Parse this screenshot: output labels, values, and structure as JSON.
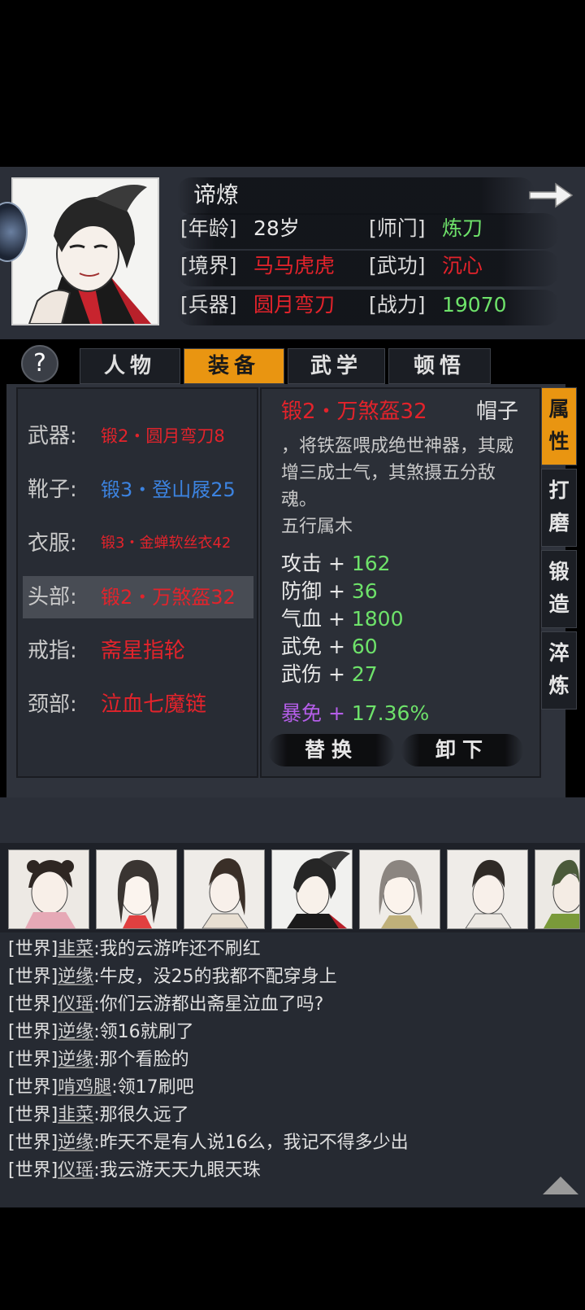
{
  "character": {
    "name": "谛燎",
    "age_label": "[年龄]",
    "age": "28岁",
    "school_label": "[师门]",
    "school": "炼刀",
    "realm_label": "[境界]",
    "realm": "马马虎虎",
    "skill_label": "[武功]",
    "skill": "沉心",
    "weapon_label": "[兵器]",
    "weapon": "圆月弯刀",
    "power_label": "[战力]",
    "power": "19070"
  },
  "tabs": {
    "help": "?",
    "items": [
      "人物",
      "装备",
      "武学",
      "顿悟"
    ],
    "active": "装备"
  },
  "equipment": [
    {
      "slot": "武器:",
      "item": "锻2・圆月弯刀8",
      "color": "#e3232b"
    },
    {
      "slot": "靴子:",
      "item": "锻3・登山屐25",
      "color": "#3c83e0"
    },
    {
      "slot": "衣服:",
      "item": "锻3・金蝉软丝衣42",
      "color": "#e3232b"
    },
    {
      "slot": "头部:",
      "item": "锻2・万煞盔32",
      "color": "#e3232b",
      "selected": true
    },
    {
      "slot": "戒指:",
      "item": "斋星指轮",
      "color": "#e3232b"
    },
    {
      "slot": "颈部:",
      "item": "泣血七魔链",
      "color": "#e3232b"
    }
  ],
  "detail": {
    "title": "锻2・万煞盔32",
    "slot": "帽子",
    "description": "，将铁盔喂成绝世神器，其威增三成士气，其煞摄五分敌魂。",
    "element": "五行属木",
    "stats": [
      {
        "name": "攻击",
        "plus": "+",
        "value": "162"
      },
      {
        "name": "防御",
        "plus": "+",
        "value": "36"
      },
      {
        "name": "气血",
        "plus": "+",
        "value": "1800"
      },
      {
        "name": "武免",
        "plus": "+",
        "value": "60"
      },
      {
        "name": "武伤",
        "plus": "+",
        "value": "27"
      }
    ],
    "special_stat": {
      "name": "暴免",
      "plus": "+",
      "value": "17.36%"
    },
    "replace_button": "替换",
    "unequip_button": "卸下"
  },
  "side_tabs": [
    {
      "label1": "属",
      "label2": "性",
      "active": true
    },
    {
      "label1": "打",
      "label2": "磨",
      "active": false
    },
    {
      "label1": "锻",
      "label2": "造",
      "active": false
    },
    {
      "label1": "淬",
      "label2": "炼",
      "active": false
    }
  ],
  "chat": [
    {
      "channel": "[世界]",
      "user": "韭菜",
      "message": ":我的云游咋还不刷红"
    },
    {
      "channel": "[世界]",
      "user": "逆缘",
      "message": ":牛皮，没25的我都不配穿身上"
    },
    {
      "channel": "[世界]",
      "user": "仪瑶",
      "message": ":你们云游都出斋星泣血了吗?"
    },
    {
      "channel": "[世界]",
      "user": "逆缘",
      "message": ":领16就刷了"
    },
    {
      "channel": "[世界]",
      "user": "逆缘",
      "message": ":那个看脸的"
    },
    {
      "channel": "[世界]",
      "user": "啃鸡腿",
      "message": ":领17刷吧"
    },
    {
      "channel": "[世界]",
      "user": "韭菜",
      "message": ":那很久远了"
    },
    {
      "channel": "[世界]",
      "user": "逆缘",
      "message": ":昨天不是有人说16么，我记不得多少出"
    },
    {
      "channel": "[世界]",
      "user": "仪瑶",
      "message": ":我云游天天九眼天珠"
    }
  ],
  "colors": {
    "accent": "#e99511",
    "red": "#e3232b",
    "green": "#6ee26a",
    "blue": "#3c83e0",
    "purple": "#b45ee8"
  }
}
